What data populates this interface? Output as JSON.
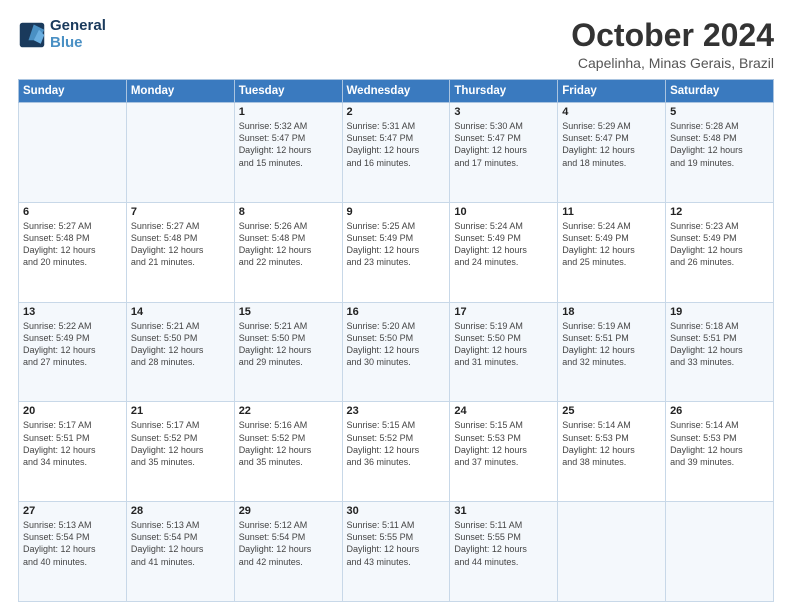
{
  "header": {
    "logo_line1": "General",
    "logo_line2": "Blue",
    "month": "October 2024",
    "location": "Capelinha, Minas Gerais, Brazil"
  },
  "weekdays": [
    "Sunday",
    "Monday",
    "Tuesday",
    "Wednesday",
    "Thursday",
    "Friday",
    "Saturday"
  ],
  "weeks": [
    [
      {
        "day": "",
        "info": ""
      },
      {
        "day": "",
        "info": ""
      },
      {
        "day": "1",
        "info": "Sunrise: 5:32 AM\nSunset: 5:47 PM\nDaylight: 12 hours\nand 15 minutes."
      },
      {
        "day": "2",
        "info": "Sunrise: 5:31 AM\nSunset: 5:47 PM\nDaylight: 12 hours\nand 16 minutes."
      },
      {
        "day": "3",
        "info": "Sunrise: 5:30 AM\nSunset: 5:47 PM\nDaylight: 12 hours\nand 17 minutes."
      },
      {
        "day": "4",
        "info": "Sunrise: 5:29 AM\nSunset: 5:47 PM\nDaylight: 12 hours\nand 18 minutes."
      },
      {
        "day": "5",
        "info": "Sunrise: 5:28 AM\nSunset: 5:48 PM\nDaylight: 12 hours\nand 19 minutes."
      }
    ],
    [
      {
        "day": "6",
        "info": "Sunrise: 5:27 AM\nSunset: 5:48 PM\nDaylight: 12 hours\nand 20 minutes."
      },
      {
        "day": "7",
        "info": "Sunrise: 5:27 AM\nSunset: 5:48 PM\nDaylight: 12 hours\nand 21 minutes."
      },
      {
        "day": "8",
        "info": "Sunrise: 5:26 AM\nSunset: 5:48 PM\nDaylight: 12 hours\nand 22 minutes."
      },
      {
        "day": "9",
        "info": "Sunrise: 5:25 AM\nSunset: 5:49 PM\nDaylight: 12 hours\nand 23 minutes."
      },
      {
        "day": "10",
        "info": "Sunrise: 5:24 AM\nSunset: 5:49 PM\nDaylight: 12 hours\nand 24 minutes."
      },
      {
        "day": "11",
        "info": "Sunrise: 5:24 AM\nSunset: 5:49 PM\nDaylight: 12 hours\nand 25 minutes."
      },
      {
        "day": "12",
        "info": "Sunrise: 5:23 AM\nSunset: 5:49 PM\nDaylight: 12 hours\nand 26 minutes."
      }
    ],
    [
      {
        "day": "13",
        "info": "Sunrise: 5:22 AM\nSunset: 5:49 PM\nDaylight: 12 hours\nand 27 minutes."
      },
      {
        "day": "14",
        "info": "Sunrise: 5:21 AM\nSunset: 5:50 PM\nDaylight: 12 hours\nand 28 minutes."
      },
      {
        "day": "15",
        "info": "Sunrise: 5:21 AM\nSunset: 5:50 PM\nDaylight: 12 hours\nand 29 minutes."
      },
      {
        "day": "16",
        "info": "Sunrise: 5:20 AM\nSunset: 5:50 PM\nDaylight: 12 hours\nand 30 minutes."
      },
      {
        "day": "17",
        "info": "Sunrise: 5:19 AM\nSunset: 5:50 PM\nDaylight: 12 hours\nand 31 minutes."
      },
      {
        "day": "18",
        "info": "Sunrise: 5:19 AM\nSunset: 5:51 PM\nDaylight: 12 hours\nand 32 minutes."
      },
      {
        "day": "19",
        "info": "Sunrise: 5:18 AM\nSunset: 5:51 PM\nDaylight: 12 hours\nand 33 minutes."
      }
    ],
    [
      {
        "day": "20",
        "info": "Sunrise: 5:17 AM\nSunset: 5:51 PM\nDaylight: 12 hours\nand 34 minutes."
      },
      {
        "day": "21",
        "info": "Sunrise: 5:17 AM\nSunset: 5:52 PM\nDaylight: 12 hours\nand 35 minutes."
      },
      {
        "day": "22",
        "info": "Sunrise: 5:16 AM\nSunset: 5:52 PM\nDaylight: 12 hours\nand 35 minutes."
      },
      {
        "day": "23",
        "info": "Sunrise: 5:15 AM\nSunset: 5:52 PM\nDaylight: 12 hours\nand 36 minutes."
      },
      {
        "day": "24",
        "info": "Sunrise: 5:15 AM\nSunset: 5:53 PM\nDaylight: 12 hours\nand 37 minutes."
      },
      {
        "day": "25",
        "info": "Sunrise: 5:14 AM\nSunset: 5:53 PM\nDaylight: 12 hours\nand 38 minutes."
      },
      {
        "day": "26",
        "info": "Sunrise: 5:14 AM\nSunset: 5:53 PM\nDaylight: 12 hours\nand 39 minutes."
      }
    ],
    [
      {
        "day": "27",
        "info": "Sunrise: 5:13 AM\nSunset: 5:54 PM\nDaylight: 12 hours\nand 40 minutes."
      },
      {
        "day": "28",
        "info": "Sunrise: 5:13 AM\nSunset: 5:54 PM\nDaylight: 12 hours\nand 41 minutes."
      },
      {
        "day": "29",
        "info": "Sunrise: 5:12 AM\nSunset: 5:54 PM\nDaylight: 12 hours\nand 42 minutes."
      },
      {
        "day": "30",
        "info": "Sunrise: 5:11 AM\nSunset: 5:55 PM\nDaylight: 12 hours\nand 43 minutes."
      },
      {
        "day": "31",
        "info": "Sunrise: 5:11 AM\nSunset: 5:55 PM\nDaylight: 12 hours\nand 44 minutes."
      },
      {
        "day": "",
        "info": ""
      },
      {
        "day": "",
        "info": ""
      }
    ]
  ]
}
